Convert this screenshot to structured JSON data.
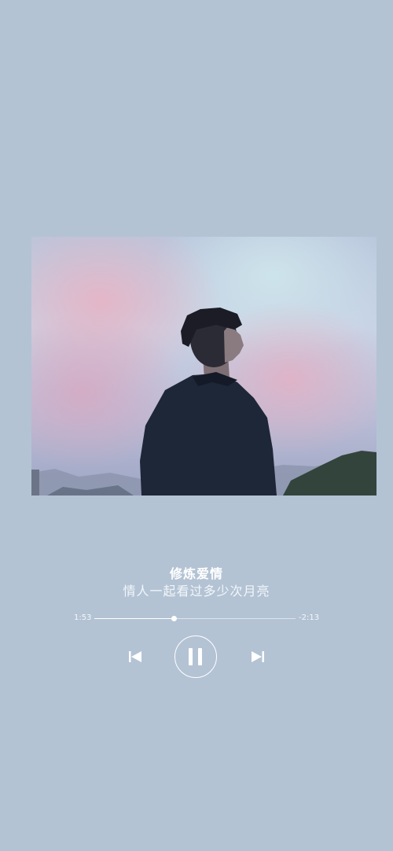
{
  "player": {
    "song_title": "修炼爱情",
    "lyric_line": "情人一起看过多少次月亮",
    "time_elapsed": "1:53",
    "time_remaining": "-2:13",
    "progress_fraction": 0.395,
    "background_color": "#b3c3d4",
    "controls": {
      "previous_icon": "skip-previous-icon",
      "pause_icon": "pause-icon",
      "next_icon": "skip-next-icon"
    }
  }
}
